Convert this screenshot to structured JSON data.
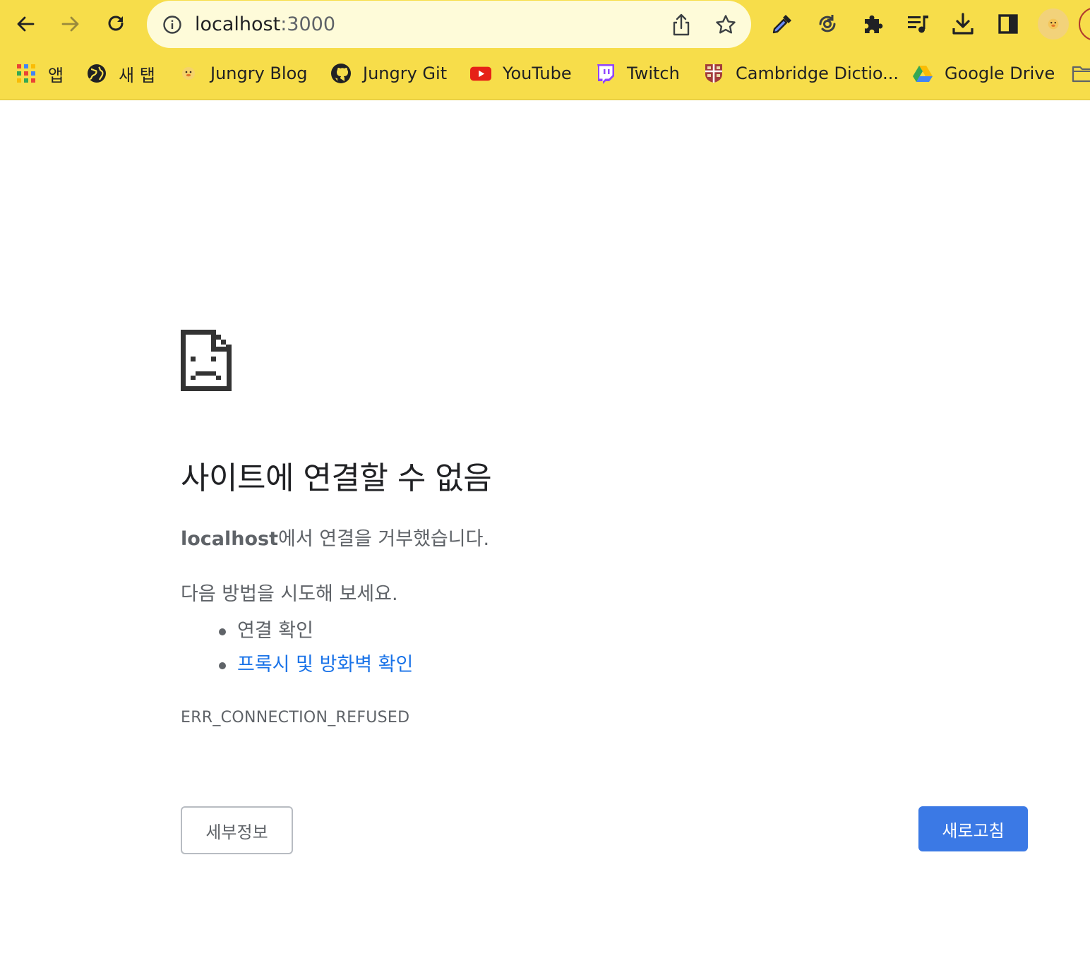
{
  "browser": {
    "omnibox": {
      "host": "localhost",
      "port": ":3000"
    },
    "bookmarks": [
      {
        "label": "앱",
        "icon": "apps-grid-icon"
      },
      {
        "label": "새 탭",
        "icon": "globe-icon"
      },
      {
        "label": "Jungry Blog",
        "icon": "duck-favicon-icon"
      },
      {
        "label": "Jungry Git",
        "icon": "github-icon"
      },
      {
        "label": "YouTube",
        "icon": "youtube-icon"
      },
      {
        "label": "Twitch",
        "icon": "twitch-icon"
      },
      {
        "label": "Cambridge Dictio...",
        "icon": "cambridge-crest-icon"
      },
      {
        "label": "Google Drive",
        "icon": "google-drive-icon"
      }
    ],
    "colors": {
      "chrome_bg": "#f7dd4a",
      "omnibox_bg": "#fefbd9"
    }
  },
  "error_page": {
    "title": "사이트에 연결할 수 없음",
    "host_bold": "localhost",
    "description_suffix": "에서 연결을 거부했습니다.",
    "suggestions_heading": "다음 방법을 시도해 보세요.",
    "suggestions": [
      {
        "text": "연결 확인",
        "is_link": false
      },
      {
        "text": "프록시 및 방화벽 확인",
        "is_link": true
      }
    ],
    "error_code": "ERR_CONNECTION_REFUSED",
    "details_button": "세부정보",
    "reload_button": "새로고침",
    "colors": {
      "link": "#1a73e8",
      "primary_button": "#3b79e5",
      "secondary_text": "#5f6368"
    }
  }
}
